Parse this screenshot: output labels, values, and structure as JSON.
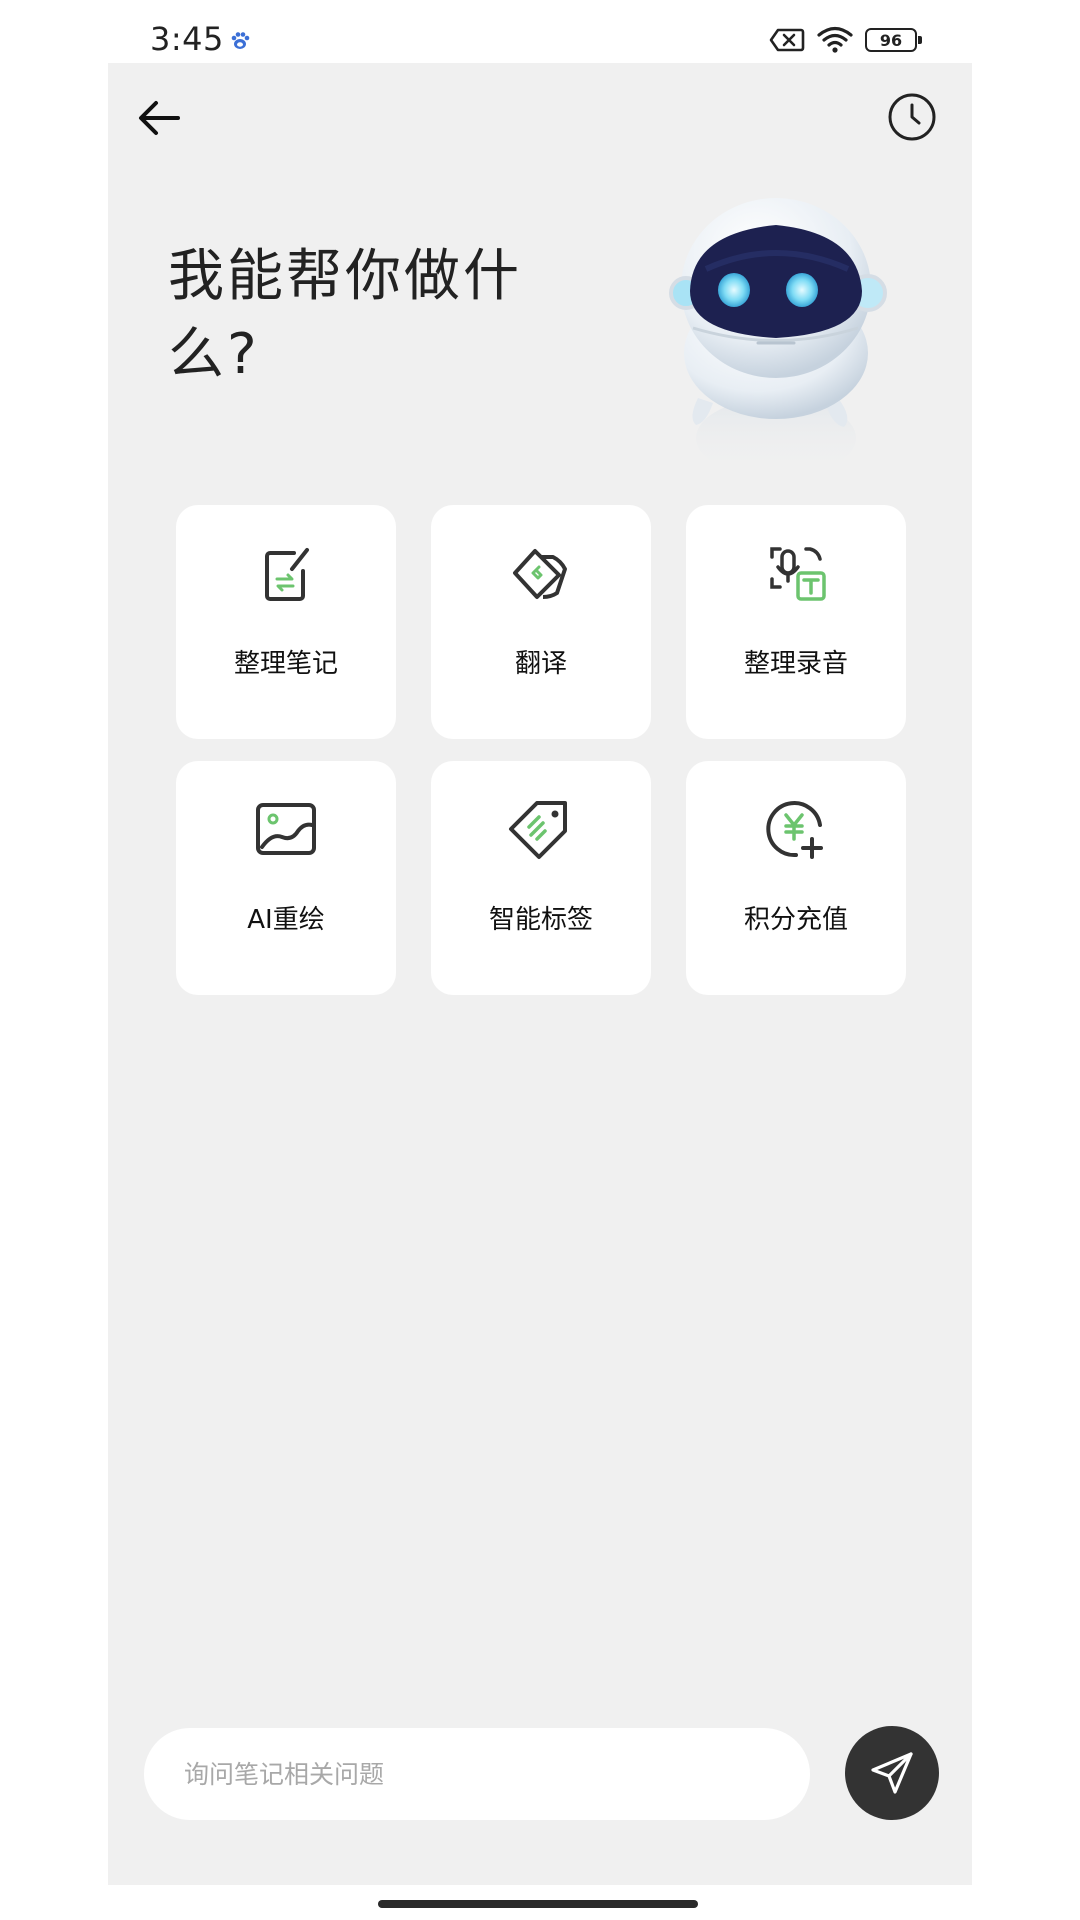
{
  "status_bar": {
    "time": "3:45",
    "battery": "96",
    "icons": [
      "baidu-paw-icon",
      "sim-error-icon",
      "wifi-icon",
      "battery-icon"
    ]
  },
  "header": {
    "back_icon": "arrow-left-icon",
    "history_icon": "clock-icon"
  },
  "hero": {
    "title": "我能帮你做什么?",
    "mascot": "robot-mascot"
  },
  "features": [
    {
      "label": "整理笔记",
      "icon": "note-edit-icon"
    },
    {
      "label": "翻译",
      "icon": "translate-cards-icon"
    },
    {
      "label": "整理录音",
      "icon": "voice-to-text-icon"
    },
    {
      "label": "AI重绘",
      "icon": "image-icon"
    },
    {
      "label": "智能标签",
      "icon": "tag-icon"
    },
    {
      "label": "积分充值",
      "icon": "yuan-recharge-icon"
    }
  ],
  "composer": {
    "placeholder": "询问笔记相关问题",
    "value": "",
    "send_icon": "paper-plane-icon"
  },
  "colors": {
    "background": "#f0f0f0",
    "card": "#ffffff",
    "accent_green": "#6cc46e",
    "icon_dark": "#333333",
    "send_button": "#333333"
  }
}
